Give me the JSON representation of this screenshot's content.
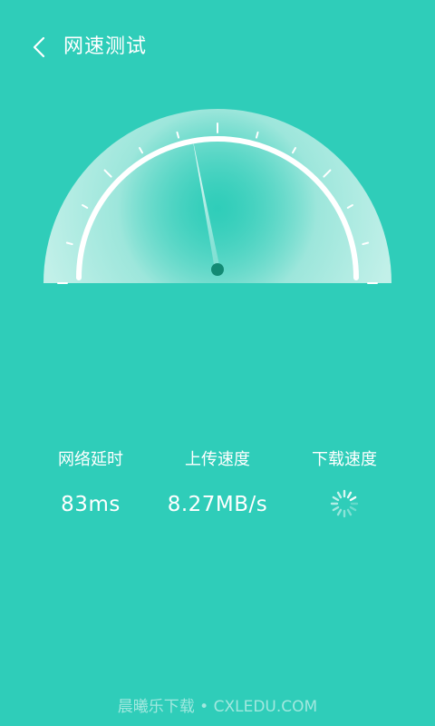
{
  "header": {
    "back_icon": "chevron-left-icon",
    "title": "网速测试"
  },
  "gauge": {
    "needle_fraction": 0.44,
    "colors": {
      "face": "#c4efe8",
      "arc": "#ffffff",
      "hub": "#138a74"
    }
  },
  "stats": {
    "latency": {
      "label": "网络延时",
      "value": "83ms"
    },
    "upload": {
      "label": "上传速度",
      "value": "8.27MB/s"
    },
    "download": {
      "label": "下载速度",
      "status": "loading-spinner-icon"
    }
  },
  "watermark": "晨曦乐下载 • CXLEDU.COM",
  "colors": {
    "background": "#2fcdb9",
    "text": "#ffffff"
  }
}
